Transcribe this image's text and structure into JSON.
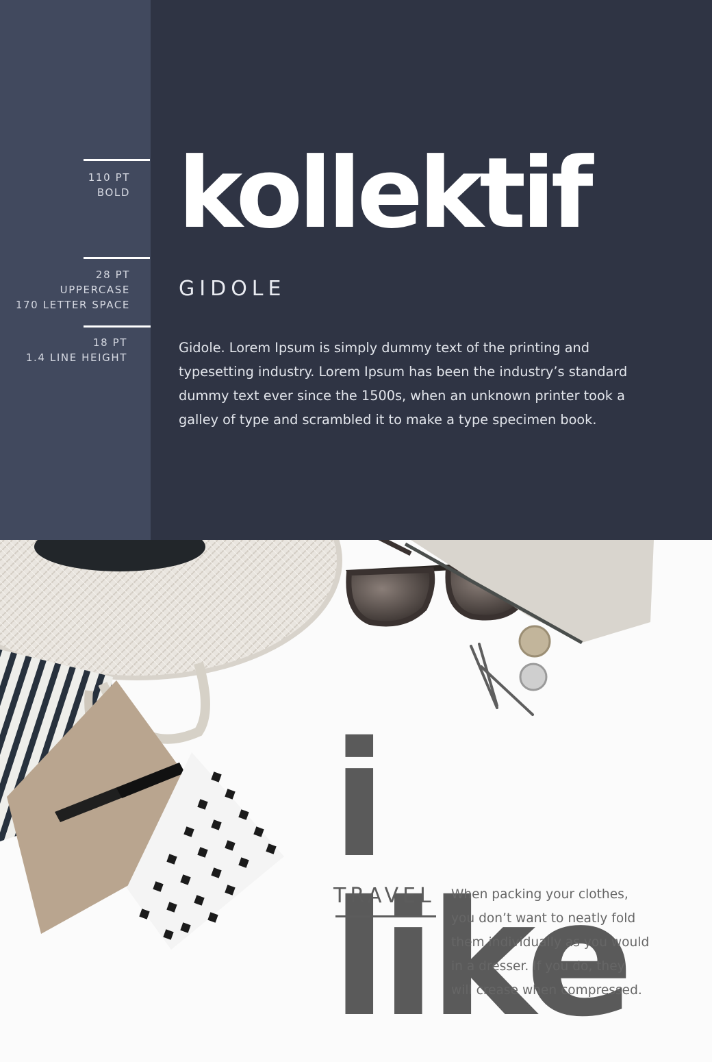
{
  "specs": [
    {
      "lines": [
        "110 PT",
        "BOLD"
      ]
    },
    {
      "lines": [
        "28 PT",
        "UPPERCASE",
        "170 LETTER SPACE"
      ]
    },
    {
      "lines": [
        "18 PT",
        "1.4 LINE HEIGHT"
      ]
    }
  ],
  "specimen": {
    "display_word": "kollektif",
    "caps_word": "GIDOLE",
    "body_lines": [
      "Gidole. Lorem Ipsum is simply dummy text of the printing and",
      "typesetting industry. Lorem Ipsum has been the industry’s standard",
      "dummy text ever since the 1500s, when an unknown printer took a",
      "galley of type and scrambled it to make a type specimen book."
    ]
  },
  "poster": {
    "headline": "i like",
    "tag": "TRAVEL",
    "caption_lines": [
      "When packing your clothes,",
      "you don’t want to neatly fold",
      "them individually as you would",
      "in a dresser. If you do, they",
      "will crease when compressed."
    ]
  },
  "colors": {
    "panel": "#2f3444",
    "sidebar": "#41495e",
    "headline": "#5a5a5a"
  }
}
